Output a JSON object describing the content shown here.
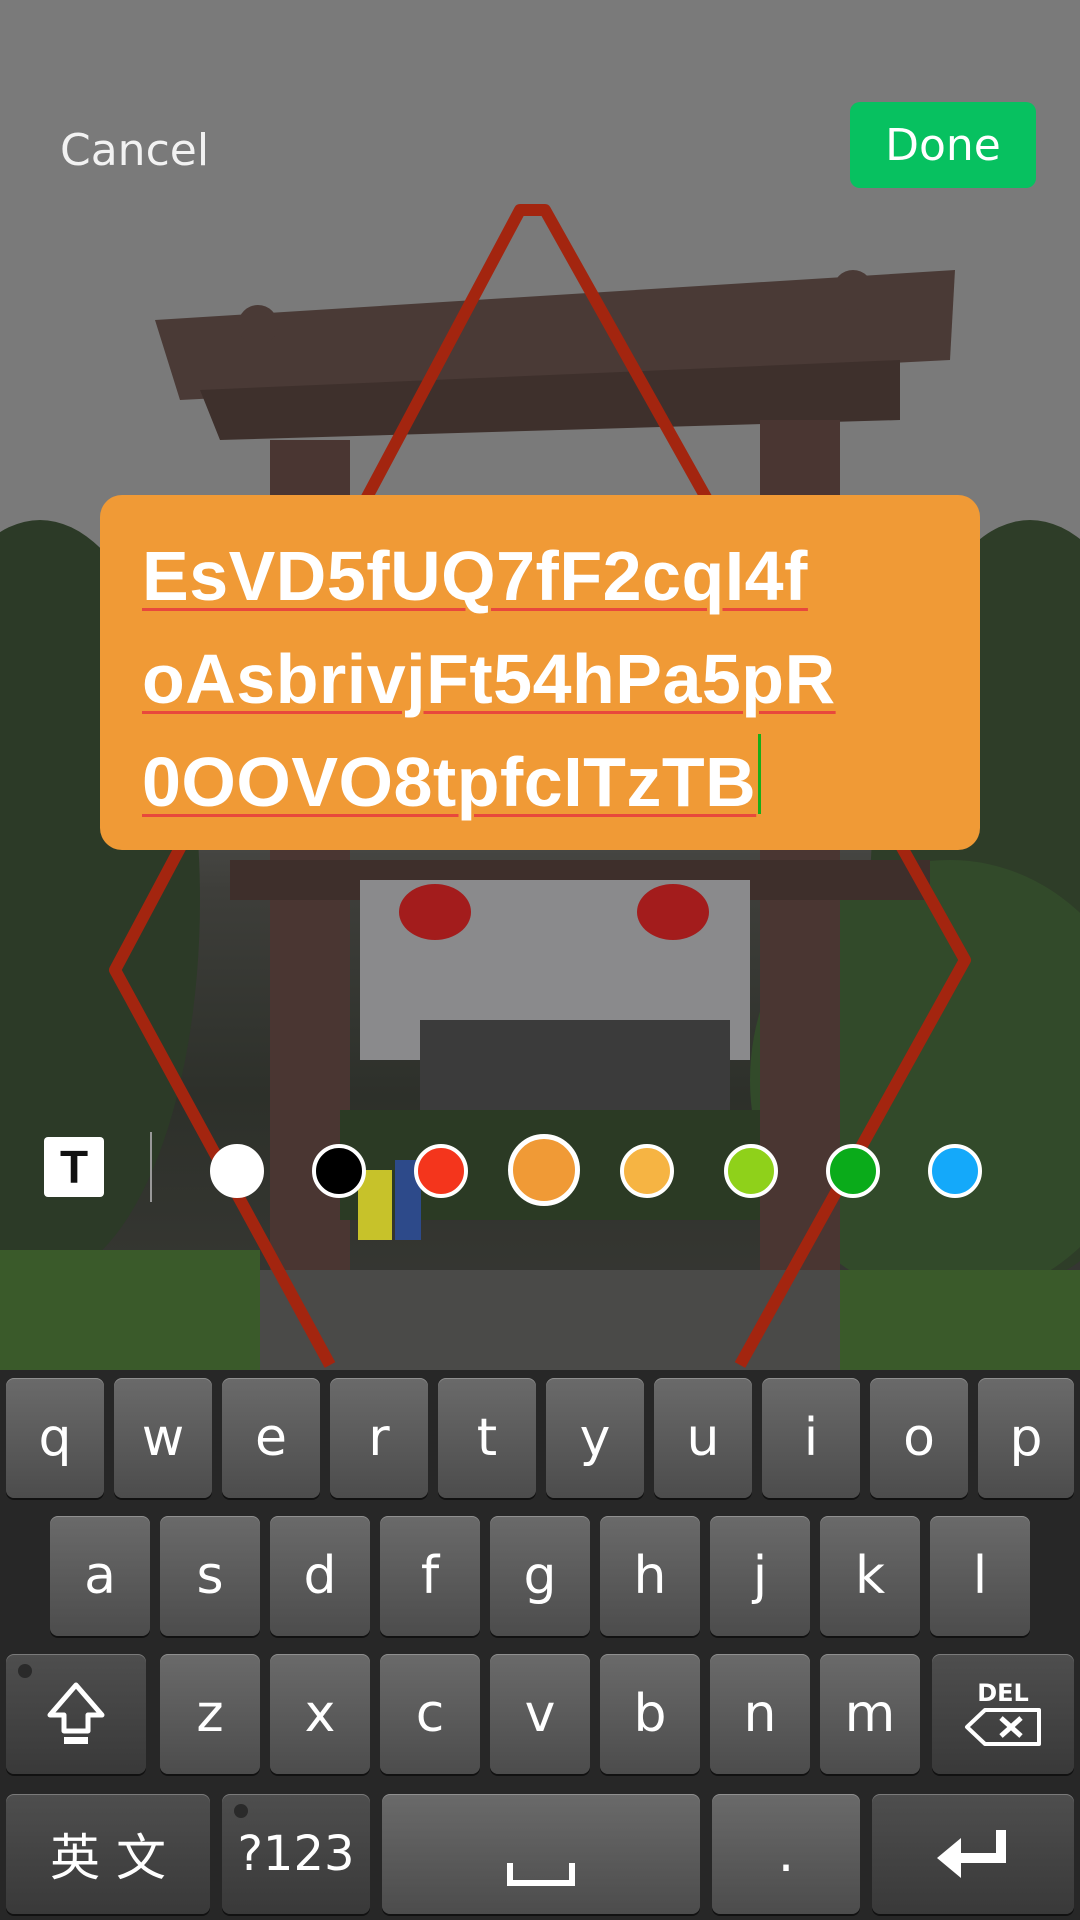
{
  "header": {
    "cancel_label": "Cancel",
    "done_label": "Done"
  },
  "editor": {
    "lines": [
      "EsVD5fUQ7fF2cqI4f",
      "oAsbrivjFt54hPa5pR",
      "0OOVO8tpfcITzTB"
    ],
    "bubble_color": "#f09a36"
  },
  "toolbar": {
    "text_tool_icon": "T",
    "colors": [
      {
        "name": "white",
        "hex": "#ffffff"
      },
      {
        "name": "black",
        "hex": "#000000"
      },
      {
        "name": "red",
        "hex": "#f4351c"
      },
      {
        "name": "orange",
        "hex": "#f09a36",
        "selected": true
      },
      {
        "name": "light-orange",
        "hex": "#f6b443"
      },
      {
        "name": "lime",
        "hex": "#8fd11a"
      },
      {
        "name": "green",
        "hex": "#0aab1a"
      },
      {
        "name": "blue",
        "hex": "#14a9fa"
      }
    ]
  },
  "keyboard": {
    "row1": [
      "q",
      "w",
      "e",
      "r",
      "t",
      "y",
      "u",
      "i",
      "o",
      "p"
    ],
    "row2": [
      "a",
      "s",
      "d",
      "f",
      "g",
      "h",
      "j",
      "k",
      "l"
    ],
    "row3": [
      "z",
      "x",
      "c",
      "v",
      "b",
      "n",
      "m"
    ],
    "shift_icon": "shift-icon",
    "del_label": "DEL",
    "lang_label": "英 文",
    "symbols_label": "?123",
    "period_label": ".",
    "space_icon": "space-icon",
    "enter_icon": "enter-icon"
  },
  "colors": {
    "accent": "#07c160",
    "drawing": "#a3250f"
  }
}
